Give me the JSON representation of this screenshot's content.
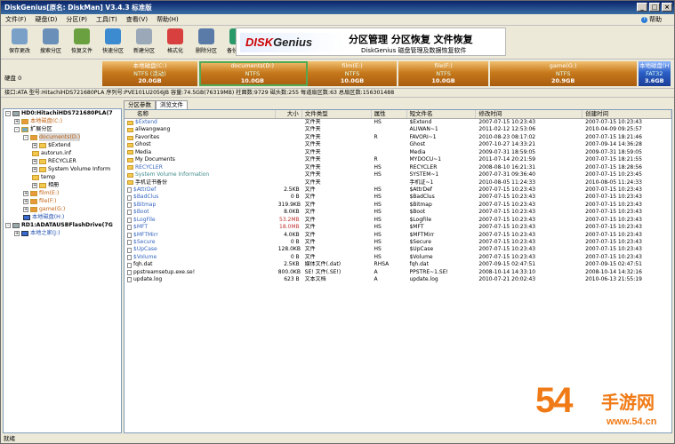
{
  "window": {
    "title": "DiskGenius[原名: DiskMan] V3.4.3 标准版"
  },
  "menu": [
    "文件(F)",
    "硬盘(D)",
    "分区(P)",
    "工具(T)",
    "查看(V)",
    "帮助(H)"
  ],
  "help": "帮助",
  "toolbar": [
    {
      "label": "保存更改",
      "icon": "save-icon",
      "color": "#7aa0c8"
    },
    {
      "label": "搜索分区",
      "icon": "search-icon",
      "color": "#6a8fb8"
    },
    {
      "label": "恢复文件",
      "icon": "recover-file-icon",
      "color": "#6aa040"
    },
    {
      "label": "快速分区",
      "icon": "quick-partition-icon",
      "color": "#3c8ad0"
    },
    {
      "label": "新建分区",
      "icon": "new-partition-icon",
      "color": "#9aa8b8"
    },
    {
      "label": "格式化",
      "icon": "format-icon",
      "color": "#d84040"
    },
    {
      "label": "删除分区",
      "icon": "delete-partition-icon",
      "color": "#5a7aa8"
    },
    {
      "label": "备份分区",
      "icon": "backup-partition-icon",
      "color": "#2a9a6a"
    }
  ],
  "banner": {
    "logo_prefix": "DISK",
    "logo_main": "Genius",
    "title": "分区管理 分区恢复 文件恢复",
    "subtitle": "DiskGenius 磁盘管理及数据恢复软件"
  },
  "disk": {
    "label": "硬盘 0",
    "partitions": [
      {
        "name": "本地磁盘(C:)",
        "fs": "NTFS (活动)",
        "size": "20.0GB",
        "color": "orange",
        "fraction": 0.17
      },
      {
        "name": "documents(D:)",
        "fs": "NTFS",
        "size": "10.0GB",
        "color": "orange",
        "fraction": 0.19,
        "selected": true
      },
      {
        "name": "film(E:)",
        "fs": "NTFS",
        "size": "10.0GB",
        "color": "orange",
        "fraction": 0.16
      },
      {
        "name": "file(F:)",
        "fs": "NTFS",
        "size": "10.0GB",
        "color": "orange",
        "fraction": 0.16
      },
      {
        "name": "game(G:)",
        "fs": "NTFS",
        "size": "20.9GB",
        "color": "orange",
        "fraction": 0.26
      },
      {
        "name": "本地磁盘(H",
        "fs": "FAT32",
        "size": "3.6GB",
        "color": "blue",
        "fraction": 0.06
      }
    ]
  },
  "info": "接口:ATA  型号:HitachiHDS721680PLA  序列号:PVE101U2056JB  容量:74.5GB(76319MB)  柱面数:9729  磁头数:255  每道扇区数:63  总扇区数:156301488",
  "tree": [
    {
      "label": "HD0:HitachiHDS721680PLA(7",
      "indent": 0,
      "exp": "-",
      "type": "disk"
    },
    {
      "label": "本地磁盘(C:)",
      "indent": 1,
      "exp": "+",
      "type": "orange"
    },
    {
      "label": "扩展分区",
      "indent": 1,
      "exp": "-",
      "type": "ext"
    },
    {
      "label": "documents(D:)",
      "indent": 2,
      "exp": "-",
      "type": "orange"
    },
    {
      "label": "$Extend",
      "indent": 3,
      "exp": "+",
      "type": "folder"
    },
    {
      "label": "autorun.inf",
      "indent": 3,
      "exp": "",
      "type": "folder"
    },
    {
      "label": "RECYCLER",
      "indent": 3,
      "exp": "+",
      "type": "folder"
    },
    {
      "label": "System Volume Inform",
      "indent": 3,
      "exp": "+",
      "type": "folder"
    },
    {
      "label": "temp",
      "indent": 3,
      "exp": "",
      "type": "folder"
    },
    {
      "label": "相册",
      "indent": 3,
      "exp": "+",
      "type": "folder"
    },
    {
      "label": "film(E:)",
      "indent": 2,
      "exp": "+",
      "type": "orange"
    },
    {
      "label": "file(F:)",
      "indent": 2,
      "exp": "+",
      "type": "orange"
    },
    {
      "label": "game(G:)",
      "indent": 2,
      "exp": "+",
      "type": "orange"
    },
    {
      "label": "本地磁盘(H:)",
      "indent": 2,
      "exp": "",
      "type": "blue"
    },
    {
      "label": "RD1:ADATAUSBFlashDrive(7G",
      "indent": 0,
      "exp": "-",
      "type": "disk"
    },
    {
      "label": "本地之家(J:)",
      "indent": 1,
      "exp": "+",
      "type": "blue"
    }
  ],
  "tabs": [
    "分区参数",
    "浏览文件"
  ],
  "columns": {
    "name": "名称",
    "size": "大小",
    "type": "文件类型",
    "attr": "属性",
    "short": "短文件名",
    "mod": "修改时间",
    "cre": "创建时间"
  },
  "files": [
    {
      "name": "$Extend",
      "size": "",
      "type": "文件夹",
      "attr": "HS",
      "short": "$Extend",
      "mod": "2007-07-15 10:23:43",
      "cre": "2007-07-15 10:23:43",
      "style": "sys",
      "icon": "folder"
    },
    {
      "name": "aliwangwang",
      "size": "",
      "type": "文件夹",
      "attr": "",
      "short": "ALIWAN~1",
      "mod": "2011-02-12 12:53:06",
      "cre": "2010-04-09 09:25:57",
      "style": "",
      "icon": "folder"
    },
    {
      "name": "Favorites",
      "size": "",
      "type": "文件夹",
      "attr": "R",
      "short": "FAVORI~1",
      "mod": "2010-08-23 08:17:02",
      "cre": "2007-07-15 18:21:46",
      "style": "",
      "icon": "folder"
    },
    {
      "name": "Ghost",
      "size": "",
      "type": "文件夹",
      "attr": "",
      "short": "Ghost",
      "mod": "2007-10-27 14:33:21",
      "cre": "2007-09-14 14:36:28",
      "style": "",
      "icon": "folder"
    },
    {
      "name": "Media",
      "size": "",
      "type": "文件夹",
      "attr": "",
      "short": "Media",
      "mod": "2009-07-31 18:59:05",
      "cre": "2009-07-31 18:59:05",
      "style": "",
      "icon": "folder"
    },
    {
      "name": "My Documents",
      "size": "",
      "type": "文件夹",
      "attr": "R",
      "short": "MYDOCU~1",
      "mod": "2011-07-14 20:21:59",
      "cre": "2007-07-15 18:21:55",
      "style": "",
      "icon": "folder"
    },
    {
      "name": "RECYCLER",
      "size": "",
      "type": "文件夹",
      "attr": "HS",
      "short": "RECYCLER",
      "mod": "2008-08-10 16:21:31",
      "cre": "2007-07-15 18:28:56",
      "style": "sys",
      "icon": "folder"
    },
    {
      "name": "System Volume Information",
      "size": "",
      "type": "文件夹",
      "attr": "HS",
      "short": "SYSTEM~1",
      "mod": "2007-07-31 09:36:40",
      "cre": "2007-07-15 10:23:45",
      "style": "hid",
      "icon": "folder"
    },
    {
      "name": "手机证书备份",
      "size": "",
      "type": "文件夹",
      "attr": "",
      "short": "手机证~1",
      "mod": "2010-08-05 11:24:33",
      "cre": "2010-08-05 11:24:33",
      "style": "",
      "icon": "folder"
    },
    {
      "name": "$AttrDef",
      "size": "2.5KB",
      "type": "文件",
      "attr": "HS",
      "short": "$AttrDef",
      "mod": "2007-07-15 10:23:43",
      "cre": "2007-07-15 10:23:43",
      "style": "sys",
      "icon": "doc"
    },
    {
      "name": "$BadClus",
      "size": "0 B",
      "type": "文件",
      "attr": "HS",
      "short": "$BadClus",
      "mod": "2007-07-15 10:23:43",
      "cre": "2007-07-15 10:23:43",
      "style": "sys",
      "icon": "doc"
    },
    {
      "name": "$Bitmap",
      "size": "319.9KB",
      "type": "文件",
      "attr": "HS",
      "short": "$Bitmap",
      "mod": "2007-07-15 10:23:43",
      "cre": "2007-07-15 10:23:43",
      "style": "sys",
      "icon": "doc"
    },
    {
      "name": "$Boot",
      "size": "8.0KB",
      "type": "文件",
      "attr": "HS",
      "short": "$Boot",
      "mod": "2007-07-15 10:23:43",
      "cre": "2007-07-15 10:23:43",
      "style": "sys",
      "icon": "doc"
    },
    {
      "name": "$LogFile",
      "size": "53.2MB",
      "type": "文件",
      "attr": "HS",
      "short": "$LogFile",
      "mod": "2007-07-15 10:23:43",
      "cre": "2007-07-15 10:23:43",
      "style": "sys",
      "icon": "doc",
      "sizered": true
    },
    {
      "name": "$MFT",
      "size": "18.0MB",
      "type": "文件",
      "attr": "HS",
      "short": "$MFT",
      "mod": "2007-07-15 10:23:43",
      "cre": "2007-07-15 10:23:43",
      "style": "sys",
      "icon": "doc",
      "sizered": true
    },
    {
      "name": "$MFTMirr",
      "size": "4.0KB",
      "type": "文件",
      "attr": "HS",
      "short": "$MFTMirr",
      "mod": "2007-07-15 10:23:43",
      "cre": "2007-07-15 10:23:43",
      "style": "sys",
      "icon": "doc"
    },
    {
      "name": "$Secure",
      "size": "0 B",
      "type": "文件",
      "attr": "HS",
      "short": "$Secure",
      "mod": "2007-07-15 10:23:43",
      "cre": "2007-07-15 10:23:43",
      "style": "sys",
      "icon": "doc"
    },
    {
      "name": "$UpCase",
      "size": "128.0KB",
      "type": "文件",
      "attr": "HS",
      "short": "$UpCase",
      "mod": "2007-07-15 10:23:43",
      "cre": "2007-07-15 10:23:43",
      "style": "sys",
      "icon": "doc"
    },
    {
      "name": "$Volume",
      "size": "0 B",
      "type": "文件",
      "attr": "HS",
      "short": "$Volume",
      "mod": "2007-07-15 10:23:43",
      "cre": "2007-07-15 10:23:43",
      "style": "sys",
      "icon": "doc"
    },
    {
      "name": "fqh.dat",
      "size": "2.5KB",
      "type": "媒体文件(.dat)",
      "attr": "RHSA",
      "short": "fqh.dat",
      "mod": "2007-09-15 02:47:51",
      "cre": "2007-09-15 02:47:51",
      "style": "",
      "icon": "doc"
    },
    {
      "name": "ppstreamsetup.exe.se!",
      "size": "800.0KB",
      "type": "SE! 文件(.SE!)",
      "attr": "A",
      "short": "PPSTRE~1.SE!",
      "mod": "2008-10-14 14:33:10",
      "cre": "2008-10-14 14:32:16",
      "style": "",
      "icon": "doc"
    },
    {
      "name": "update.log",
      "size": "623 B",
      "type": "文本文档",
      "attr": "A",
      "short": "update.log",
      "mod": "2010-07-21 20:02:43",
      "cre": "2010-06-13 21:55:19",
      "style": "",
      "icon": "doc"
    }
  ],
  "status": "就绪",
  "watermark": {
    "num": "54",
    "cn": "手游网",
    "url": "www.54.cn"
  }
}
